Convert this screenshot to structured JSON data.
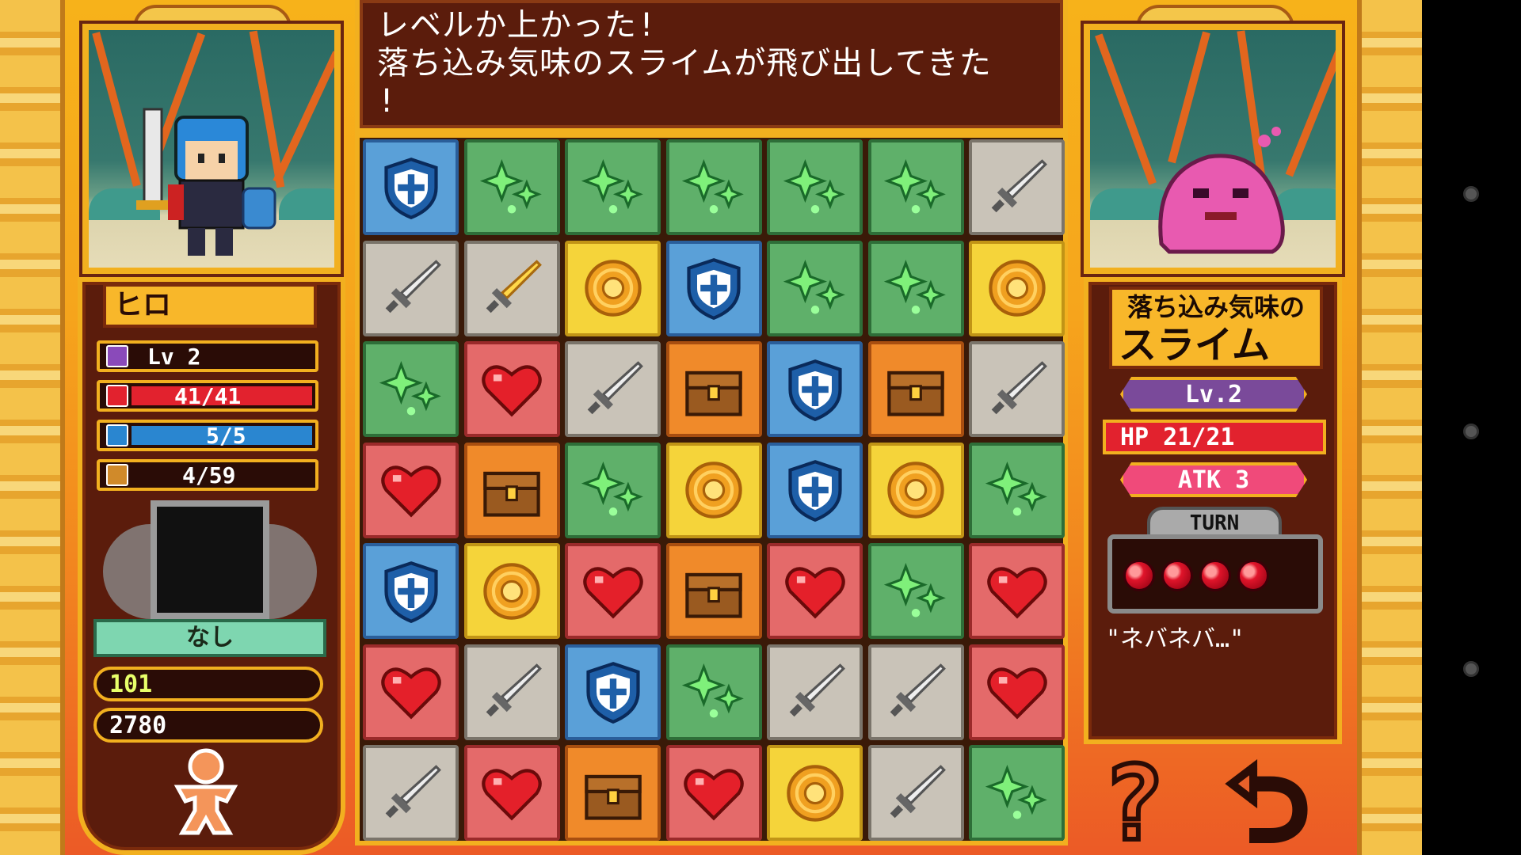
{
  "dialog": {
    "text": "レベルか上かった!\n落ち込み気味のスライムが飛び出してきた\n!"
  },
  "player": {
    "name": "ヒロ",
    "level": "Lv 2",
    "hp": "41/41",
    "def": "5/5",
    "exp": "4/59",
    "equip": "なし",
    "gold": "101",
    "score": "2780"
  },
  "enemy": {
    "name_line1": "落ち込み気味の",
    "name_line2": "スライム",
    "level": "Lv.2",
    "hp": "HP 21/21",
    "atk": "ATK 3",
    "turn_label": "TURN",
    "turn_count": 4,
    "line": "\"ネバネバ…\""
  },
  "buttons": {
    "help": "?",
    "back": "⮌"
  },
  "colors": {
    "accent": "#f2b01f",
    "panel": "#5b1c0c",
    "hp": "#e2222e",
    "def": "#2a86d0",
    "atk": "#f04a7a",
    "lv": "#7a4a9a"
  },
  "board": {
    "rows": [
      [
        "shield",
        "gem",
        "gem",
        "gem",
        "gem",
        "gem",
        "sword"
      ],
      [
        "sword",
        "fire",
        "gold",
        "shield",
        "gem",
        "gem",
        "gold"
      ],
      [
        "gem",
        "heart",
        "sword",
        "chest",
        "shield",
        "chest",
        "sword"
      ],
      [
        "heart",
        "chest",
        "gem",
        "gold",
        "shield",
        "gold",
        "gem"
      ],
      [
        "shield",
        "gold",
        "heart",
        "chest",
        "heart",
        "gem",
        "heart"
      ],
      [
        "heart",
        "sword",
        "shield",
        "gem",
        "sword",
        "sword",
        "heart"
      ],
      [
        "sword",
        "heart",
        "chest",
        "heart",
        "gold",
        "sword",
        "gem"
      ]
    ]
  }
}
